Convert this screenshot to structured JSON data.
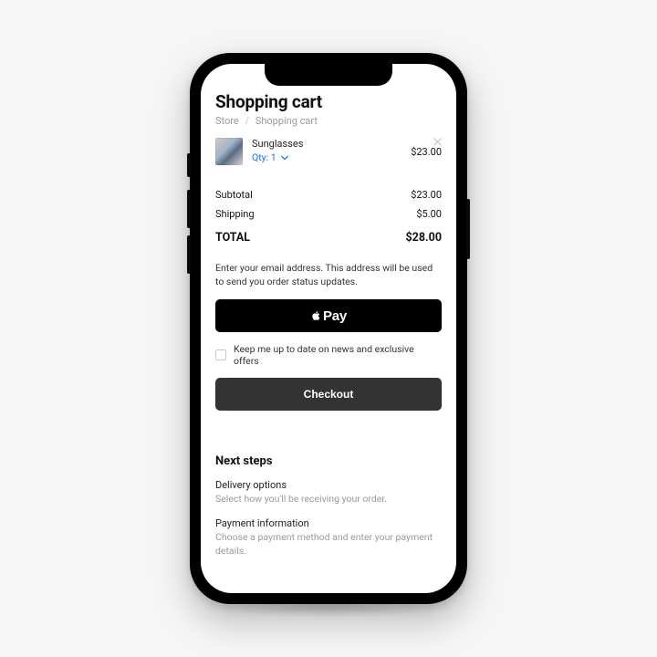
{
  "page": {
    "title": "Shopping cart",
    "breadcrumb": {
      "root": "Store",
      "current": "Shopping cart",
      "sep": "/"
    }
  },
  "cart": {
    "items": [
      {
        "name": "Sunglasses",
        "qty_label": "Qty: 1",
        "price": "$23.00"
      }
    ]
  },
  "summary": {
    "subtotal_label": "Subtotal",
    "subtotal_value": "$23.00",
    "shipping_label": "Shipping",
    "shipping_value": "$5.00",
    "total_label": "TOTAL",
    "total_value": "$28.00"
  },
  "email_helper": "Enter your email address. This address will be used to send you order status updates.",
  "apple_pay": {
    "word": "Pay"
  },
  "newsletter": {
    "label": "Keep me up to date on news and exclusive offers"
  },
  "checkout": {
    "label": "Checkout"
  },
  "next_steps": {
    "heading": "Next steps",
    "items": [
      {
        "label": "Delivery options",
        "desc": "Select how you'll be receiving your order."
      },
      {
        "label": "Payment information",
        "desc": "Choose a payment method and enter your payment details."
      }
    ]
  }
}
